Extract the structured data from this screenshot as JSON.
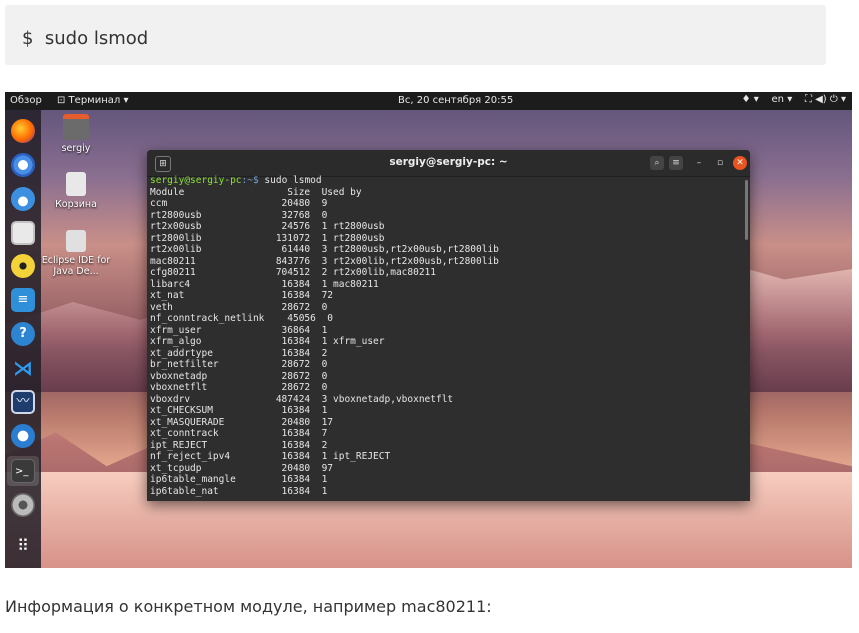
{
  "command": "$  sudo lsmod",
  "caption": "Информация о конкретном модуле, например mac80211:",
  "topbar": {
    "activities": "Обзор",
    "app_menu": "⊡ Терминал ▾",
    "clock": "Вс, 20 сентября  20:55",
    "status": "♦ ▾    en ▾    ⛶ ◀) ⏻ ▾"
  },
  "desktop": {
    "icons": [
      {
        "label": "sergiy"
      },
      {
        "label": "Корзина"
      },
      {
        "label": "Eclipse IDE for Java De..."
      }
    ]
  },
  "dock": {
    "apps": [
      "firefox-icon",
      "chromium-icon",
      "thunderbird-icon",
      "files-icon",
      "rhythmbox-icon",
      "writer-icon",
      "help-icon",
      "vscode-icon",
      "monitor-icon",
      "crossover-icon",
      "terminal-icon",
      "settings-icon",
      "apps-grid-icon"
    ]
  },
  "terminal": {
    "title": "sergiy@sergiy-pc: ~",
    "prompt_user": "sergiy@sergiy-pc",
    "prompt_path": ":~$",
    "command": " sudo lsmod",
    "output": "Module                  Size  Used by\nccm                    20480  9\nrt2800usb              32768  0\nrt2x00usb              24576  1 rt2800usb\nrt2800lib             131072  1 rt2800usb\nrt2x00lib              61440  3 rt2800usb,rt2x00usb,rt2800lib\nmac80211              843776  3 rt2x00lib,rt2x00usb,rt2800lib\ncfg80211              704512  2 rt2x00lib,mac80211\nlibarc4                16384  1 mac80211\nxt_nat                 16384  72\nveth                   28672  0\nnf_conntrack_netlink    45056  0\nxfrm_user              36864  1\nxfrm_algo              16384  1 xfrm_user\nxt_addrtype            16384  2\nbr_netfilter           28672  0\nvboxnetadp             28672  0\nvboxnetflt             28672  0\nvboxdrv               487424  3 vboxnetadp,vboxnetflt\nxt_CHECKSUM            16384  1\nxt_MASQUERADE          20480  17\nxt_conntrack           16384  7\nipt_REJECT             16384  2\nnf_reject_ipv4         16384  1 ipt_REJECT\nxt_tcpudp              20480  97\nip6table_mangle        16384  1\nip6table_nat           16384  1"
  }
}
